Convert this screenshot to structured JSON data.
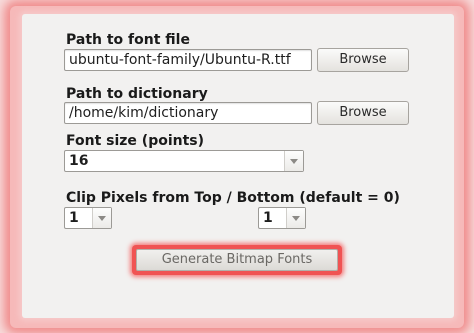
{
  "font_path": {
    "label": "Path to font file",
    "value": "ubuntu-font-family/Ubuntu-R.ttf",
    "browse_label": "Browse"
  },
  "dictionary_path": {
    "label": "Path to dictionary",
    "value": "/home/kim/dictionary",
    "browse_label": "Browse"
  },
  "font_size": {
    "label": "Font size (points)",
    "value": "16"
  },
  "clip_pixels": {
    "label": "Clip Pixels from Top / Bottom (default = 0)",
    "top_value": "1",
    "bottom_value": "1"
  },
  "generate_button": {
    "label": "Generate Bitmap Fonts"
  },
  "colors": {
    "highlight": "#f05353",
    "panel": "#f2f1f0"
  }
}
